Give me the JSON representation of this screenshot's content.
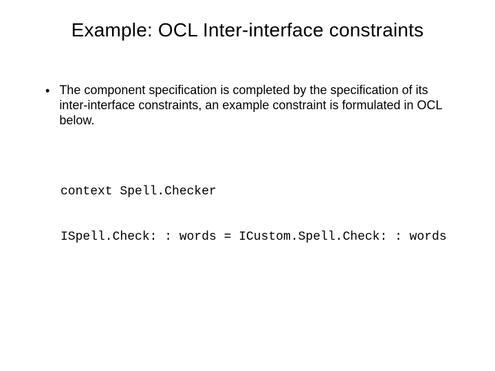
{
  "title": "Example: OCL Inter-interface constraints",
  "bullet": "The component specification is completed by the specification of its inter-interface constraints, an example constraint is formulated in OCL below.",
  "code_line1": "context Spell.Checker",
  "code_line2": "ISpell.Check: : words = ICustom.Spell.Check: : words"
}
